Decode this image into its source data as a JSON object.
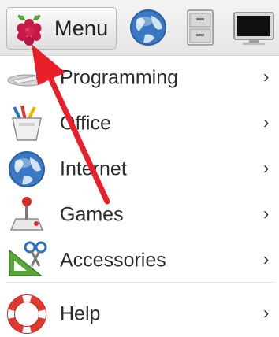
{
  "taskbar": {
    "menu_label": "Menu",
    "launchers": [
      "web-browser-icon",
      "file-manager-icon",
      "terminal-icon"
    ]
  },
  "menu": {
    "items": [
      {
        "label": "Programming",
        "icon": "programming-icon",
        "submenu_glyph": "›"
      },
      {
        "label": "Office",
        "icon": "office-icon",
        "submenu_glyph": "›"
      },
      {
        "label": "Internet",
        "icon": "internet-icon",
        "submenu_glyph": "›"
      },
      {
        "label": "Games",
        "icon": "games-icon",
        "submenu_glyph": "›"
      },
      {
        "label": "Accessories",
        "icon": "accessories-icon",
        "submenu_glyph": "›"
      },
      {
        "label": "Help",
        "icon": "help-icon",
        "submenu_glyph": "›"
      }
    ]
  },
  "annotation": {
    "arrow_color": "#e8202a"
  }
}
